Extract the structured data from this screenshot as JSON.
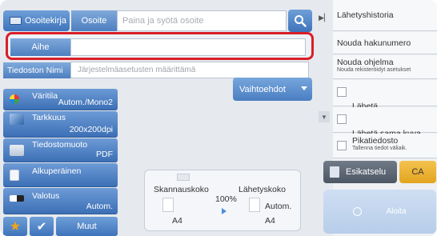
{
  "header": {
    "address_book_label": "Osoitekirja",
    "to_label": "Osoite",
    "to_placeholder": "Paina ja syötä osoite"
  },
  "subject": {
    "label": "Aihe",
    "value": ""
  },
  "filename": {
    "label": "Tiedoston Nimi",
    "placeholder": "Järjestelmäasetusten määrittämä"
  },
  "options_button": "Vaihtoehdot",
  "settings": [
    {
      "title": "Väritila",
      "value": "Autom./Mono2",
      "icon": "color-mode-icon"
    },
    {
      "title": "Tarkkuus",
      "value": "200x200dpi",
      "icon": "resolution-icon"
    },
    {
      "title": "Tiedostomuoto",
      "value": "PDF",
      "icon": "file-format-icon"
    },
    {
      "title": "Alkuperäinen",
      "value": "",
      "icon": "original-icon"
    },
    {
      "title": "Valotus",
      "value": "Autom.",
      "icon": "exposure-icon"
    }
  ],
  "bottom": {
    "other_label": "Muut"
  },
  "preview_box": {
    "scan_size_label": "Skannauskoko",
    "scan_size_value": "A4",
    "ratio": "100%",
    "send_size_label": "Lähetyskoko",
    "send_size_mode": "Autom.",
    "send_size_value": "A4"
  },
  "right_panel": {
    "items": [
      {
        "label": "Lähetyshistoria"
      },
      {
        "label": "Nouda hakunumero"
      },
      {
        "label": "Nouda ohjelma",
        "sub": "Nouda rekisteröidyt asetukset"
      },
      {
        "label": "Lähetä\nKohteen linkki",
        "checkbox": true
      },
      {
        "label": "Lähetä sama kuva\nkuin faksiosoite",
        "checkbox": true
      },
      {
        "label": "Pikatiedosto",
        "sub": "Tallenna tiedot väliaik.",
        "checkbox": true
      }
    ],
    "preview_label": "Esikatselu",
    "ca_label": "CA",
    "start_label": "Aloita"
  },
  "colors": {
    "accent_blue": "#4a7ec2",
    "highlight_red": "#d81f28",
    "ca_yellow": "#e8ae2a"
  }
}
